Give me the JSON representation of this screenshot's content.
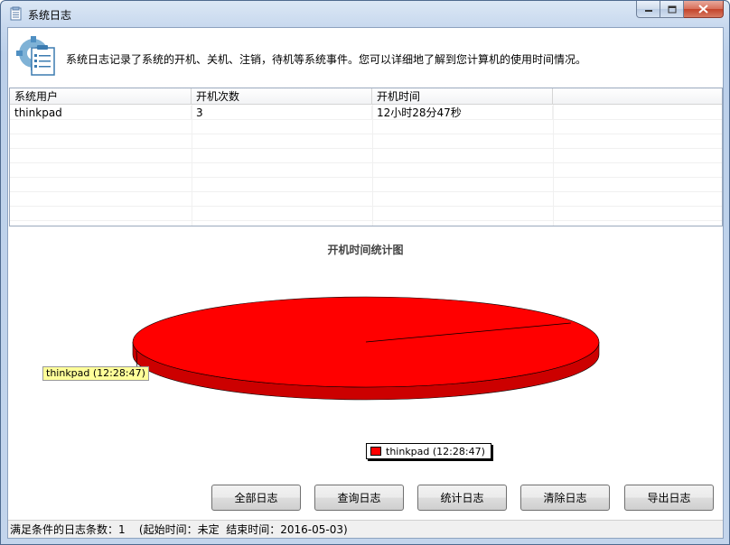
{
  "window": {
    "title": "系统日志"
  },
  "header": {
    "description": "系统日志记录了系统的开机、关机、注销，待机等系统事件。您可以详细地了解到您计算机的使用时间情况。"
  },
  "table": {
    "columns": [
      "系统用户",
      "开机次数",
      "开机时间",
      ""
    ],
    "rows": [
      [
        "thinkpad",
        "3",
        "12小时28分47秒",
        ""
      ]
    ]
  },
  "chart_data": {
    "type": "pie",
    "title": "开机时间统计图",
    "categories": [
      "thinkpad (12:28:47)"
    ],
    "values": [
      100
    ],
    "colors": [
      "#ff0000"
    ],
    "callout": "thinkpad (12:28:47)",
    "legend": "thinkpad (12:28:47)",
    "legend_position": "bottom"
  },
  "buttons": {
    "all": "全部日志",
    "query": "查询日志",
    "stats": "统计日志",
    "clear": "清除日志",
    "export": "导出日志"
  },
  "status": {
    "count_label": "满足条件的日志条数：",
    "count": "1",
    "range": "(起始时间：未定  结束时间：2016-05-03)"
  },
  "colors": {
    "pie": "#ff0000",
    "pie_side": "#cc0000"
  }
}
